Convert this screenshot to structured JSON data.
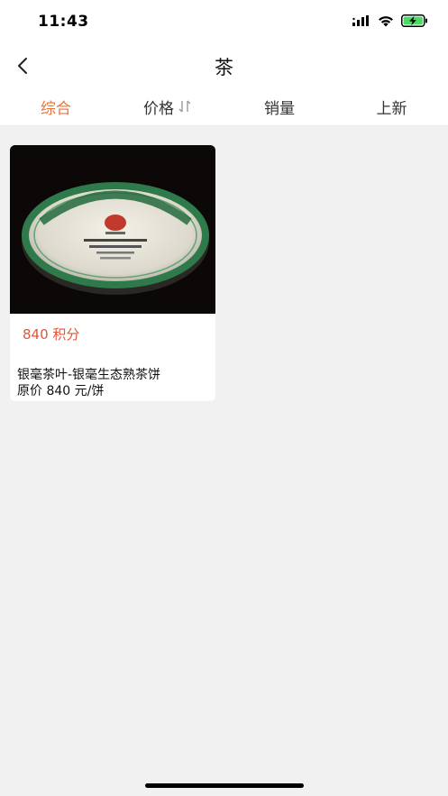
{
  "status_bar": {
    "time": "11:43"
  },
  "nav": {
    "title": "茶"
  },
  "sort_tabs": [
    {
      "label": "综合",
      "active": true
    },
    {
      "label": "价格",
      "active": false
    },
    {
      "label": "销量",
      "active": false
    },
    {
      "label": "上新",
      "active": false
    }
  ],
  "products": [
    {
      "points": "840 积分",
      "name": "银毫茶叶-银毫生态熟茶饼",
      "original_price": "原价 840 元/饼"
    }
  ],
  "colors": {
    "accent": "#e8733a",
    "points": "#e0563a",
    "background": "#f1f1f1"
  }
}
